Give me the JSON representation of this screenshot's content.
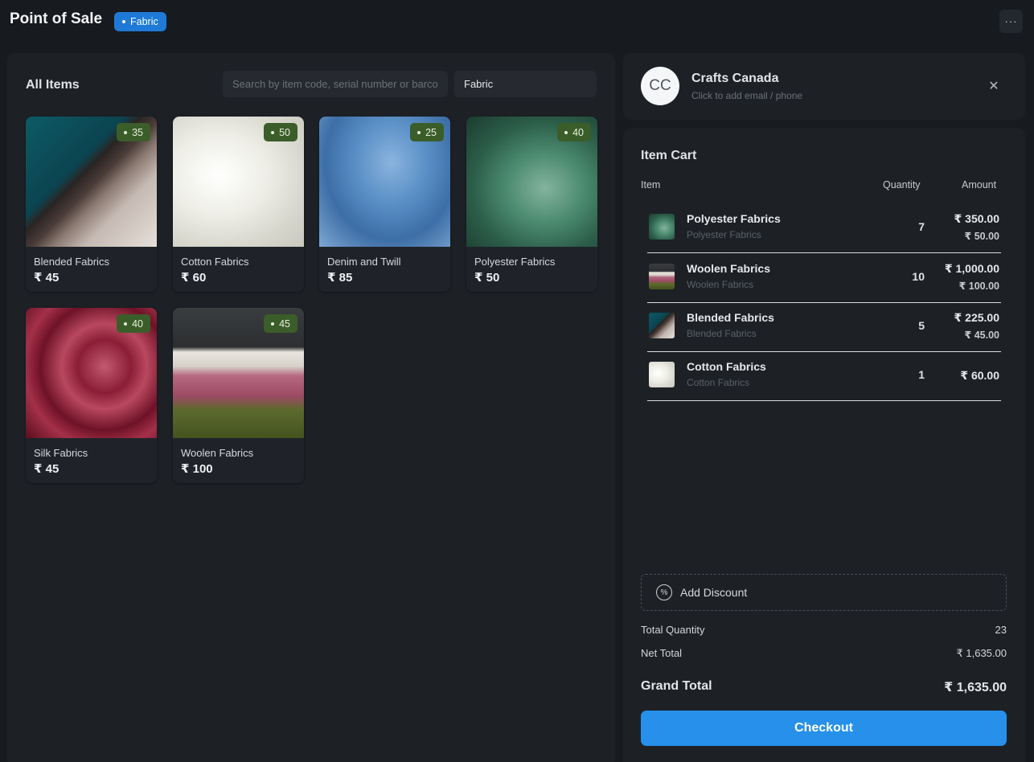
{
  "header": {
    "title": "Point of Sale",
    "profile_badge": "Fabric",
    "more_label": "···"
  },
  "items_panel": {
    "title": "All Items",
    "search_placeholder": "Search by item code, serial number or barcode",
    "item_group": "Fabric",
    "items": [
      {
        "name": "Blended Fabrics",
        "price": "₹ 45",
        "stock": "35"
      },
      {
        "name": "Cotton Fabrics",
        "price": "₹ 60",
        "stock": "50"
      },
      {
        "name": "Denim and Twill",
        "price": "₹ 85",
        "stock": "25"
      },
      {
        "name": "Polyester Fabrics",
        "price": "₹ 50",
        "stock": "40"
      },
      {
        "name": "Silk Fabrics",
        "price": "₹ 45",
        "stock": "40"
      },
      {
        "name": "Woolen Fabrics",
        "price": "₹ 100",
        "stock": "45"
      }
    ]
  },
  "customer": {
    "initials": "CC",
    "name": "Crafts Canada",
    "subtitle": "Click to add email / phone",
    "close_icon": "✕"
  },
  "cart": {
    "title": "Item Cart",
    "columns": {
      "item": "Item",
      "quantity": "Quantity",
      "amount": "Amount"
    },
    "rows": [
      {
        "name": "Polyester Fabrics",
        "sub": "Polyester Fabrics",
        "qty": "7",
        "amount": "₹ 350.00",
        "rate": "₹ 50.00"
      },
      {
        "name": "Woolen Fabrics",
        "sub": "Woolen Fabrics",
        "qty": "10",
        "amount": "₹ 1,000.00",
        "rate": "₹ 100.00"
      },
      {
        "name": "Blended Fabrics",
        "sub": "Blended Fabrics",
        "qty": "5",
        "amount": "₹ 225.00",
        "rate": "₹ 45.00"
      },
      {
        "name": "Cotton Fabrics",
        "sub": "Cotton Fabrics",
        "qty": "1",
        "amount": "₹ 60.00",
        "rate": ""
      }
    ],
    "add_discount": "Add Discount",
    "total_quantity_label": "Total Quantity",
    "total_quantity": "23",
    "net_total_label": "Net Total",
    "net_total": "₹ 1,635.00",
    "grand_total_label": "Grand Total",
    "grand_total": "₹ 1,635.00",
    "checkout": "Checkout"
  },
  "colors": {
    "accent": "#2690ea",
    "badge_blue": "#1e7ad6",
    "stock_green": "#3b5d2a",
    "panel_bg": "#1d2126",
    "page_bg": "#171a1f"
  }
}
